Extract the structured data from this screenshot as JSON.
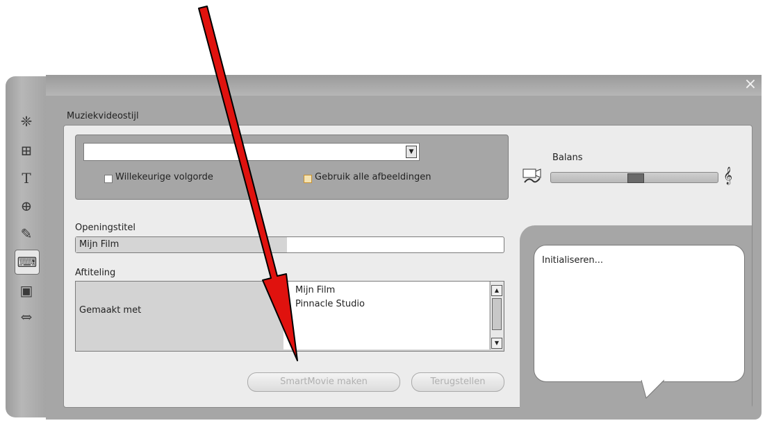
{
  "window": {
    "close_label": "×"
  },
  "toolbar": {
    "items": [
      {
        "name": "album",
        "glyph": "❈"
      },
      {
        "name": "video-titles",
        "glyph": "⊞"
      },
      {
        "name": "titles",
        "glyph": "T"
      },
      {
        "name": "effects",
        "glyph": "⊕"
      },
      {
        "name": "audio-effects",
        "glyph": "✎"
      },
      {
        "name": "smartmovie",
        "glyph": "⌨"
      },
      {
        "name": "dvd-menu",
        "glyph": "▣"
      },
      {
        "name": "transitions",
        "glyph": "⇔"
      }
    ]
  },
  "style": {
    "heading": "Muziekvideostijl",
    "dropdown_value": "",
    "random_order_label": "Willekeurige volgorde",
    "use_all_images_label": "Gebruik alle afbeeldingen",
    "random_order_checked": false,
    "use_all_images_checked": false
  },
  "balance": {
    "label": "Balans",
    "level": 0.5
  },
  "opening_title": {
    "label": "Openingstitel",
    "value": "Mijn Film"
  },
  "credits": {
    "label": "Aftiteling",
    "left_text": "Gemaakt met",
    "lines": [
      "Mijn Film",
      "Pinnacle Studio"
    ]
  },
  "buttons": {
    "make": "SmartMovie maken",
    "reset": "Terugstellen"
  },
  "status": {
    "text": "Initialiseren..."
  },
  "colors": {
    "arrow": "#e0120e",
    "arrow_outline": "#000000"
  }
}
